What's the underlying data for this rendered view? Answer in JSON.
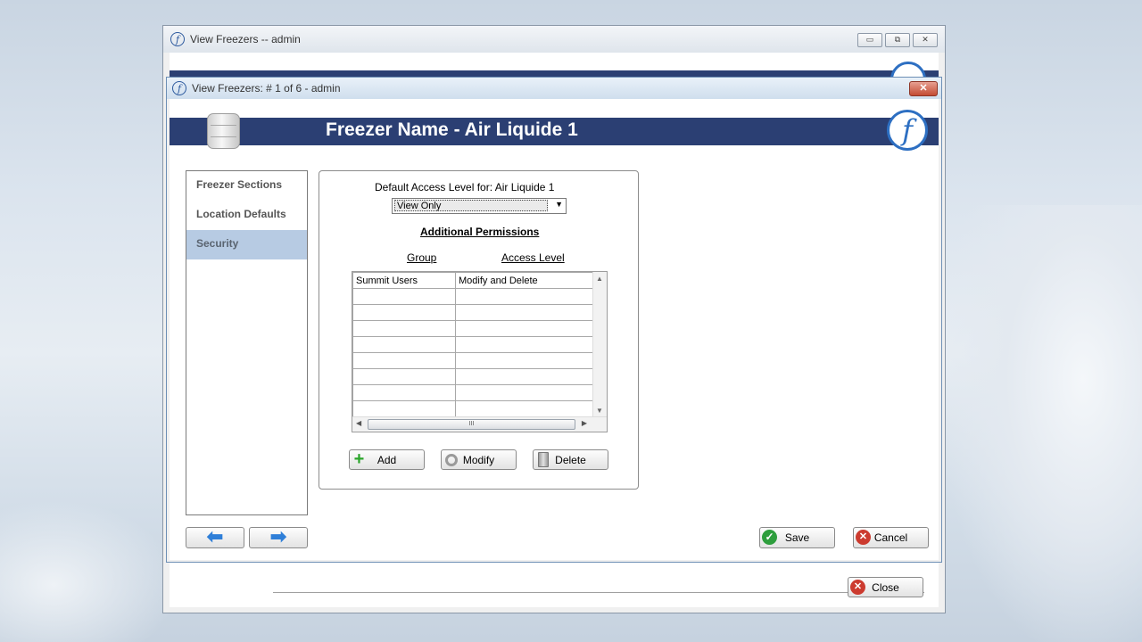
{
  "outer_window": {
    "title": "View Freezers -- admin",
    "controls": {
      "minimize": "▭",
      "restore": "⧉",
      "close": "✕"
    },
    "close_button": "Close"
  },
  "inner_window": {
    "title": "View Freezers: # 1 of 6 - admin",
    "close_glyph": "✕",
    "banner_title": "Freezer Name - Air Liquide 1",
    "logo_glyph": "f"
  },
  "nav": {
    "items": [
      {
        "label": "Freezer Sections",
        "active": false
      },
      {
        "label": "Location Defaults",
        "active": false
      },
      {
        "label": "Security",
        "active": true
      }
    ]
  },
  "security": {
    "default_access_label": "Default Access Level for: Air Liquide 1",
    "default_access_value": "View Only",
    "additional_permissions_heading": "Additional Permissions",
    "columns": {
      "group": "Group",
      "access_level": "Access Level"
    },
    "rows": [
      {
        "group": "Summit Users",
        "access": "Modify and Delete"
      }
    ],
    "scroll_thumb_glyph": "III",
    "buttons": {
      "add": "Add",
      "modify": "Modify",
      "delete": "Delete"
    }
  },
  "footer": {
    "prev_glyph": "⬅",
    "next_glyph": "➡",
    "save": "Save",
    "cancel": "Cancel"
  },
  "icons": {
    "app": "app-logo-icon",
    "freezer": "database-icon",
    "add": "plus-icon",
    "modify": "gear-icon",
    "delete": "trash-icon",
    "save": "check-icon",
    "cancel": "cancel-x-icon"
  },
  "colors": {
    "banner": "#2b3f73",
    "nav_active": "#b7cbe3",
    "accent_blue": "#2d6fc2"
  }
}
